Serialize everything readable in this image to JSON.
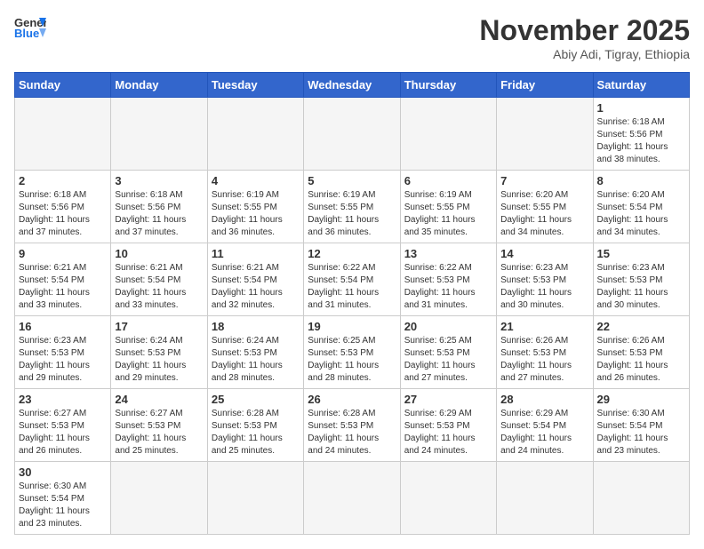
{
  "header": {
    "logo_general": "General",
    "logo_blue": "Blue",
    "month_title": "November 2025",
    "location": "Abiy Adi, Tigray, Ethiopia"
  },
  "weekdays": [
    "Sunday",
    "Monday",
    "Tuesday",
    "Wednesday",
    "Thursday",
    "Friday",
    "Saturday"
  ],
  "weeks": [
    [
      {
        "day": "",
        "info": ""
      },
      {
        "day": "",
        "info": ""
      },
      {
        "day": "",
        "info": ""
      },
      {
        "day": "",
        "info": ""
      },
      {
        "day": "",
        "info": ""
      },
      {
        "day": "",
        "info": ""
      },
      {
        "day": "1",
        "info": "Sunrise: 6:18 AM\nSunset: 5:56 PM\nDaylight: 11 hours\nand 38 minutes."
      }
    ],
    [
      {
        "day": "2",
        "info": "Sunrise: 6:18 AM\nSunset: 5:56 PM\nDaylight: 11 hours\nand 37 minutes."
      },
      {
        "day": "3",
        "info": "Sunrise: 6:18 AM\nSunset: 5:56 PM\nDaylight: 11 hours\nand 37 minutes."
      },
      {
        "day": "4",
        "info": "Sunrise: 6:19 AM\nSunset: 5:55 PM\nDaylight: 11 hours\nand 36 minutes."
      },
      {
        "day": "5",
        "info": "Sunrise: 6:19 AM\nSunset: 5:55 PM\nDaylight: 11 hours\nand 36 minutes."
      },
      {
        "day": "6",
        "info": "Sunrise: 6:19 AM\nSunset: 5:55 PM\nDaylight: 11 hours\nand 35 minutes."
      },
      {
        "day": "7",
        "info": "Sunrise: 6:20 AM\nSunset: 5:55 PM\nDaylight: 11 hours\nand 34 minutes."
      },
      {
        "day": "8",
        "info": "Sunrise: 6:20 AM\nSunset: 5:54 PM\nDaylight: 11 hours\nand 34 minutes."
      }
    ],
    [
      {
        "day": "9",
        "info": "Sunrise: 6:21 AM\nSunset: 5:54 PM\nDaylight: 11 hours\nand 33 minutes."
      },
      {
        "day": "10",
        "info": "Sunrise: 6:21 AM\nSunset: 5:54 PM\nDaylight: 11 hours\nand 33 minutes."
      },
      {
        "day": "11",
        "info": "Sunrise: 6:21 AM\nSunset: 5:54 PM\nDaylight: 11 hours\nand 32 minutes."
      },
      {
        "day": "12",
        "info": "Sunrise: 6:22 AM\nSunset: 5:54 PM\nDaylight: 11 hours\nand 31 minutes."
      },
      {
        "day": "13",
        "info": "Sunrise: 6:22 AM\nSunset: 5:53 PM\nDaylight: 11 hours\nand 31 minutes."
      },
      {
        "day": "14",
        "info": "Sunrise: 6:23 AM\nSunset: 5:53 PM\nDaylight: 11 hours\nand 30 minutes."
      },
      {
        "day": "15",
        "info": "Sunrise: 6:23 AM\nSunset: 5:53 PM\nDaylight: 11 hours\nand 30 minutes."
      }
    ],
    [
      {
        "day": "16",
        "info": "Sunrise: 6:23 AM\nSunset: 5:53 PM\nDaylight: 11 hours\nand 29 minutes."
      },
      {
        "day": "17",
        "info": "Sunrise: 6:24 AM\nSunset: 5:53 PM\nDaylight: 11 hours\nand 29 minutes."
      },
      {
        "day": "18",
        "info": "Sunrise: 6:24 AM\nSunset: 5:53 PM\nDaylight: 11 hours\nand 28 minutes."
      },
      {
        "day": "19",
        "info": "Sunrise: 6:25 AM\nSunset: 5:53 PM\nDaylight: 11 hours\nand 28 minutes."
      },
      {
        "day": "20",
        "info": "Sunrise: 6:25 AM\nSunset: 5:53 PM\nDaylight: 11 hours\nand 27 minutes."
      },
      {
        "day": "21",
        "info": "Sunrise: 6:26 AM\nSunset: 5:53 PM\nDaylight: 11 hours\nand 27 minutes."
      },
      {
        "day": "22",
        "info": "Sunrise: 6:26 AM\nSunset: 5:53 PM\nDaylight: 11 hours\nand 26 minutes."
      }
    ],
    [
      {
        "day": "23",
        "info": "Sunrise: 6:27 AM\nSunset: 5:53 PM\nDaylight: 11 hours\nand 26 minutes."
      },
      {
        "day": "24",
        "info": "Sunrise: 6:27 AM\nSunset: 5:53 PM\nDaylight: 11 hours\nand 25 minutes."
      },
      {
        "day": "25",
        "info": "Sunrise: 6:28 AM\nSunset: 5:53 PM\nDaylight: 11 hours\nand 25 minutes."
      },
      {
        "day": "26",
        "info": "Sunrise: 6:28 AM\nSunset: 5:53 PM\nDaylight: 11 hours\nand 24 minutes."
      },
      {
        "day": "27",
        "info": "Sunrise: 6:29 AM\nSunset: 5:53 PM\nDaylight: 11 hours\nand 24 minutes."
      },
      {
        "day": "28",
        "info": "Sunrise: 6:29 AM\nSunset: 5:54 PM\nDaylight: 11 hours\nand 24 minutes."
      },
      {
        "day": "29",
        "info": "Sunrise: 6:30 AM\nSunset: 5:54 PM\nDaylight: 11 hours\nand 23 minutes."
      }
    ],
    [
      {
        "day": "30",
        "info": "Sunrise: 6:30 AM\nSunset: 5:54 PM\nDaylight: 11 hours\nand 23 minutes."
      },
      {
        "day": "",
        "info": ""
      },
      {
        "day": "",
        "info": ""
      },
      {
        "day": "",
        "info": ""
      },
      {
        "day": "",
        "info": ""
      },
      {
        "day": "",
        "info": ""
      },
      {
        "day": "",
        "info": ""
      }
    ]
  ]
}
